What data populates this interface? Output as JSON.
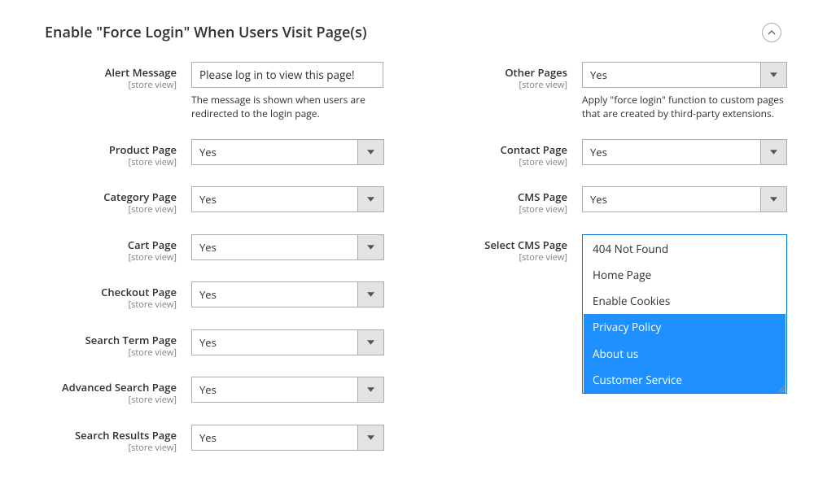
{
  "section": {
    "title": "Enable \"Force Login\" When Users Visit Page(s)"
  },
  "scope_label": "[store view]",
  "fields": {
    "alert_message": {
      "label": "Alert Message",
      "value": "Please log in to view this page!",
      "note": "The message is shown when users are redirected to the login page."
    },
    "product_page": {
      "label": "Product Page",
      "value": "Yes"
    },
    "category_page": {
      "label": "Category Page",
      "value": "Yes"
    },
    "cart_page": {
      "label": "Cart Page",
      "value": "Yes"
    },
    "checkout_page": {
      "label": "Checkout Page",
      "value": "Yes"
    },
    "search_term": {
      "label": "Search Term Page",
      "value": "Yes"
    },
    "adv_search": {
      "label": "Advanced Search Page",
      "value": "Yes"
    },
    "search_results": {
      "label": "Search Results Page",
      "value": "Yes"
    },
    "other_pages": {
      "label": "Other Pages",
      "value": "Yes",
      "note": "Apply \"force login\" function to custom pages that are created by third-party extensions."
    },
    "contact_page": {
      "label": "Contact Page",
      "value": "Yes"
    },
    "cms_page": {
      "label": "CMS Page",
      "value": "Yes"
    },
    "select_cms": {
      "label": "Select CMS Page",
      "options": [
        {
          "label": "404 Not Found",
          "selected": false
        },
        {
          "label": "Home Page",
          "selected": false
        },
        {
          "label": "Enable Cookies",
          "selected": false
        },
        {
          "label": "Privacy Policy",
          "selected": true
        },
        {
          "label": "About us",
          "selected": true
        },
        {
          "label": "Customer Service",
          "selected": true
        }
      ]
    }
  }
}
